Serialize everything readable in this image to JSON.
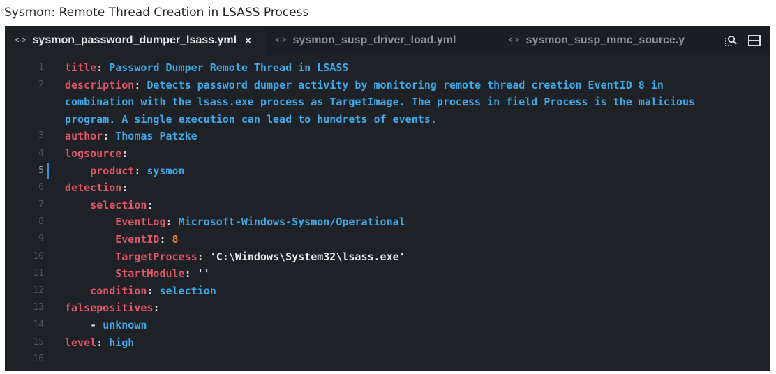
{
  "caption": "Sysmon: Remote Thread Creation in LSASS Process",
  "tabs": [
    {
      "icon": "<·>",
      "label": "sysmon_password_dumper_lsass.yml",
      "close": "×",
      "active": true
    },
    {
      "icon": "<·>",
      "label": "sysmon_susp_driver_load.yml",
      "active": false
    },
    {
      "icon": "<·>",
      "label": "sysmon_susp_mmc_source.y",
      "active": false
    }
  ],
  "tools": {
    "search_icon": "search-preview-icon",
    "split_icon": "split-editor-icon"
  },
  "colors": {
    "key": "#e0556b",
    "value": "#3fa9e8",
    "string": "#e7e9ec",
    "number": "#f07f3a",
    "background": "#1e2227"
  },
  "current_line": 5,
  "lines": [
    {
      "num": "1",
      "indent": "",
      "key": "title",
      "sep": ": ",
      "value": "Password Dumper Remote Thread in LSASS"
    },
    {
      "num": "2",
      "indent": "",
      "key": "description",
      "sep": ": ",
      "value": "Detects password dumper activity by monitoring remote thread creation EventID 8 in"
    },
    {
      "num": "",
      "indent": "",
      "key": "",
      "sep": "",
      "value": "combination with the lsass.exe process as TargetImage. The process in field Process is the malicious"
    },
    {
      "num": "",
      "indent": "",
      "key": "",
      "sep": "",
      "value": "program. A single execution can lead to hundrets of events."
    },
    {
      "num": "3",
      "indent": "",
      "key": "author",
      "sep": ": ",
      "value": "Thomas Patzke"
    },
    {
      "num": "4",
      "indent": "",
      "key": "logsource",
      "sep": ":",
      "value": ""
    },
    {
      "num": "5",
      "indent": "    ",
      "key": "product",
      "sep": ": ",
      "value": "sysmon"
    },
    {
      "num": "6",
      "indent": "",
      "key": "detection",
      "sep": ":",
      "value": ""
    },
    {
      "num": "7",
      "indent": "    ",
      "key": "selection",
      "sep": ":",
      "value": ""
    },
    {
      "num": "8",
      "indent": "        ",
      "key": "EventLog",
      "sep": ": ",
      "value": "Microsoft-Windows-Sysmon/Operational"
    },
    {
      "num": "9",
      "indent": "        ",
      "key": "EventID",
      "sep": ": ",
      "value": "8",
      "type": "number"
    },
    {
      "num": "10",
      "indent": "        ",
      "key": "TargetProcess",
      "sep": ": ",
      "value": "'C:\\Windows\\System32\\lsass.exe'",
      "type": "string"
    },
    {
      "num": "11",
      "indent": "        ",
      "key": "StartModule",
      "sep": ": ",
      "value": "''",
      "type": "string"
    },
    {
      "num": "12",
      "indent": "    ",
      "key": "condition",
      "sep": ": ",
      "value": "selection"
    },
    {
      "num": "13",
      "indent": "",
      "key": "falsepositives",
      "sep": ":",
      "value": ""
    },
    {
      "num": "14",
      "indent": "    ",
      "key": "",
      "sep": "- ",
      "value": "unknown"
    },
    {
      "num": "15",
      "indent": "",
      "key": "level",
      "sep": ": ",
      "value": "high"
    },
    {
      "num": "16",
      "indent": "",
      "key": "",
      "sep": "",
      "value": ""
    }
  ]
}
